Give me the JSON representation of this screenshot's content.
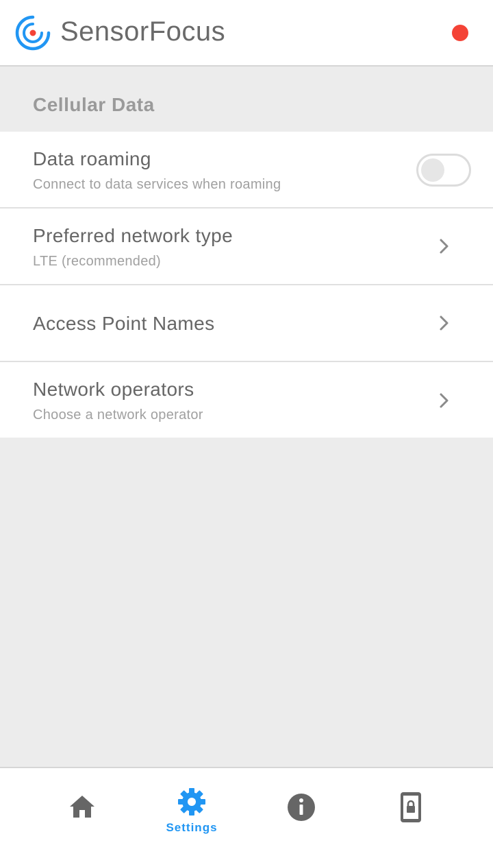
{
  "header": {
    "app_title": "SensorFocus",
    "status_color": "#f44336",
    "logo_icon": "target-logo-icon"
  },
  "section": {
    "title": "Cellular Data"
  },
  "settings": [
    {
      "title": "Data roaming",
      "subtitle": "Connect to data services when roaming",
      "control": "toggle",
      "enabled": false
    },
    {
      "title": "Preferred network type",
      "subtitle": "LTE (recommended)",
      "control": "chevron"
    },
    {
      "title": "Access Point Names",
      "subtitle": "",
      "control": "chevron"
    },
    {
      "title": "Network operators",
      "subtitle": "Choose a network operator",
      "control": "chevron"
    }
  ],
  "bottom_nav": {
    "active_color": "#2196f3",
    "items": [
      {
        "icon": "home-icon",
        "label": ""
      },
      {
        "icon": "gear-icon",
        "label": "Settings",
        "active": true
      },
      {
        "icon": "info-icon",
        "label": ""
      },
      {
        "icon": "phone-lock-icon",
        "label": ""
      }
    ]
  }
}
